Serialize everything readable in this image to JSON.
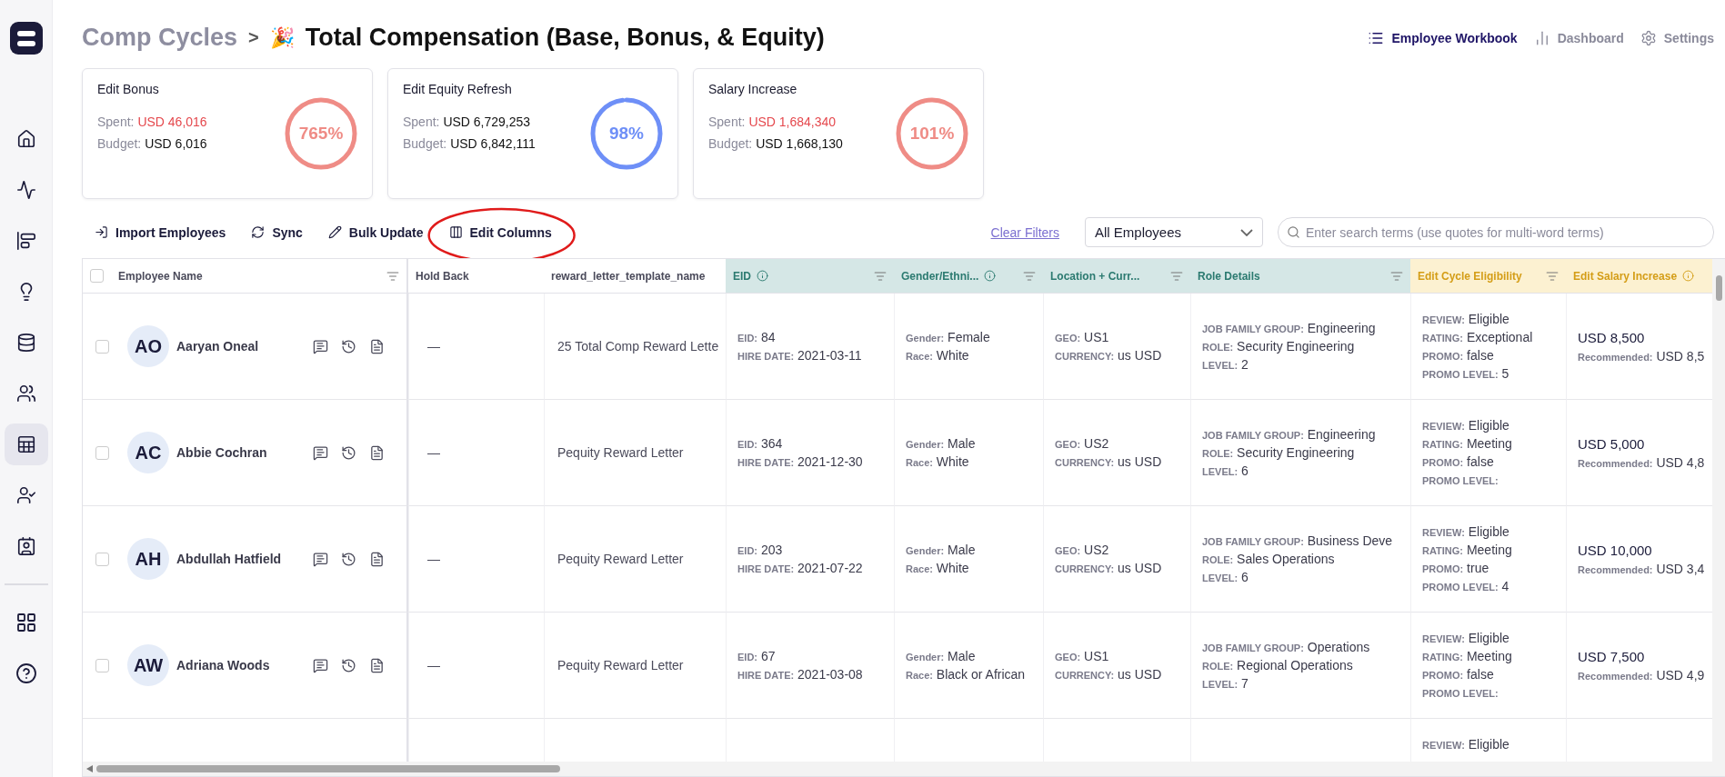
{
  "sidebar": {
    "items": [
      {
        "selected": false
      },
      {
        "selected": false
      },
      {
        "selected": false
      },
      {
        "selected": false
      },
      {
        "selected": false
      },
      {
        "selected": false
      },
      {
        "selected": true
      },
      {
        "selected": false
      },
      {
        "selected": false
      }
    ],
    "bottom": [
      {
        "selected": false
      },
      {
        "selected": false
      }
    ]
  },
  "breadcrumb": {
    "parent": "Comp Cycles",
    "separator": ">",
    "emoji": "🎉",
    "title": "Total Compensation (Base, Bonus, & Equity)"
  },
  "nav": [
    {
      "label": "Employee Workbook",
      "selected": true
    },
    {
      "label": "Dashboard",
      "selected": false
    },
    {
      "label": "Settings",
      "selected": false
    }
  ],
  "cards": [
    {
      "title": "Edit Bonus",
      "spent_label": "Spent:",
      "spent": "USD 46,016",
      "over": true,
      "budget_label": "Budget:",
      "budget": "USD 6,016",
      "percent": "765%",
      "level": 1,
      "color": "#ef8c86"
    },
    {
      "title": "Edit Equity Refresh",
      "spent_label": "Spent:",
      "spent": "USD 6,729,253",
      "over": false,
      "budget_label": "Budget:",
      "budget": "USD 6,842,111",
      "percent": "98%",
      "level": 0.98,
      "color": "#6e8ff7"
    },
    {
      "title": "Salary Increase",
      "spent_label": "Spent:",
      "spent": "USD 1,684,340",
      "over": true,
      "budget_label": "Budget:",
      "budget": "USD 1,668,130",
      "percent": "101%",
      "level": 1,
      "color": "#ef8c86"
    }
  ],
  "toolbar": {
    "actions": [
      {
        "label": "Import Employees",
        "highlighted": false
      },
      {
        "label": "Sync",
        "highlighted": false
      },
      {
        "label": "Bulk Update",
        "highlighted": false
      },
      {
        "label": "Edit Columns",
        "highlighted": true
      }
    ],
    "clear_filters": "Clear Filters",
    "filter_select": "All Employees",
    "search": {
      "placeholder": "Enter search terms (use quotes for multi-word terms)"
    }
  },
  "table": {
    "select_all": {
      "checked": false
    },
    "columns": [
      {
        "label": "Employee Name",
        "kind": "plain",
        "info": false,
        "filter": true
      },
      {
        "label": "Hold Back",
        "kind": "plain",
        "info": false,
        "filter": false
      },
      {
        "label": "reward_letter_template_name",
        "kind": "plain",
        "info": false,
        "filter": false
      },
      {
        "label": "EID",
        "kind": "teal",
        "info": true,
        "filter": true
      },
      {
        "label": "Gender/Ethni...",
        "kind": "teal",
        "info": true,
        "filter": true
      },
      {
        "label": "Location + Curr...",
        "kind": "teal",
        "info": false,
        "filter": true
      },
      {
        "label": "Role Details",
        "kind": "teal",
        "info": false,
        "filter": true
      },
      {
        "label": "Edit Cycle Eligibility",
        "kind": "gold",
        "info": false,
        "filter": true
      },
      {
        "label": "Edit Salary Increase",
        "kind": "gold",
        "info": true,
        "filter": false
      }
    ],
    "rows": [
      {
        "checked": false,
        "initials": "AO",
        "name": "Aaryan Oneal",
        "hold_back": "—",
        "reward_letter": "25 Total Comp Reward Lette",
        "eid": [
          {
            "label": "EID:",
            "value": "84"
          },
          {
            "label": "HIRE DATE:",
            "value": "2021-03-11"
          }
        ],
        "gender": [
          {
            "label": "Gender:",
            "value": "Female"
          },
          {
            "label": "Race:",
            "value": "White"
          }
        ],
        "location": [
          {
            "label": "GEO:",
            "value": "US1"
          },
          {
            "label": "CURRENCY:",
            "value": "us USD"
          }
        ],
        "role": [
          {
            "label": "JOB FAMILY GROUP:",
            "value": "Engineering"
          },
          {
            "label": "ROLE:",
            "value": "Security Engineering"
          },
          {
            "label": "LEVEL:",
            "value": "2"
          }
        ],
        "cycle": [
          {
            "label": "REVIEW:",
            "value": "Eligible"
          },
          {
            "label": "RATING:",
            "value": "Exceptional"
          },
          {
            "label": "PROMO:",
            "value": "false"
          },
          {
            "label": "PROMO LEVEL:",
            "value": "5"
          }
        ],
        "salary": "USD 8,500",
        "recommended_label": "Recommended:",
        "recommended": "USD 8,5"
      },
      {
        "checked": false,
        "initials": "AC",
        "name": "Abbie Cochran",
        "hold_back": "—",
        "reward_letter": "Pequity Reward Letter",
        "eid": [
          {
            "label": "EID:",
            "value": "364"
          },
          {
            "label": "HIRE DATE:",
            "value": "2021-12-30"
          }
        ],
        "gender": [
          {
            "label": "Gender:",
            "value": "Male"
          },
          {
            "label": "Race:",
            "value": "White"
          }
        ],
        "location": [
          {
            "label": "GEO:",
            "value": "US2"
          },
          {
            "label": "CURRENCY:",
            "value": "us USD"
          }
        ],
        "role": [
          {
            "label": "JOB FAMILY GROUP:",
            "value": "Engineering"
          },
          {
            "label": "ROLE:",
            "value": "Security Engineering"
          },
          {
            "label": "LEVEL:",
            "value": "6"
          }
        ],
        "cycle": [
          {
            "label": "REVIEW:",
            "value": "Eligible"
          },
          {
            "label": "RATING:",
            "value": "Meeting"
          },
          {
            "label": "PROMO:",
            "value": "false"
          },
          {
            "label": "PROMO LEVEL:"
          }
        ],
        "salary": "USD 5,000",
        "recommended_label": "Recommended:",
        "recommended": "USD 4,8"
      },
      {
        "checked": false,
        "initials": "AH",
        "name": "Abdullah Hatfield",
        "hold_back": "—",
        "reward_letter": "Pequity Reward Letter",
        "eid": [
          {
            "label": "EID:",
            "value": "203"
          },
          {
            "label": "HIRE DATE:",
            "value": "2021-07-22"
          }
        ],
        "gender": [
          {
            "label": "Gender:",
            "value": "Male"
          },
          {
            "label": "Race:",
            "value": "White"
          }
        ],
        "location": [
          {
            "label": "GEO:",
            "value": "US2"
          },
          {
            "label": "CURRENCY:",
            "value": "us USD"
          }
        ],
        "role": [
          {
            "label": "JOB FAMILY GROUP:",
            "value": "Business Deve"
          },
          {
            "label": "ROLE:",
            "value": "Sales Operations"
          },
          {
            "label": "LEVEL:",
            "value": "6"
          }
        ],
        "cycle": [
          {
            "label": "REVIEW:",
            "value": "Eligible"
          },
          {
            "label": "RATING:",
            "value": "Meeting"
          },
          {
            "label": "PROMO:",
            "value": "true"
          },
          {
            "label": "PROMO LEVEL:",
            "value": "4"
          }
        ],
        "salary": "USD 10,000",
        "recommended_label": "Recommended:",
        "recommended": "USD 3,4"
      },
      {
        "checked": false,
        "initials": "AW",
        "name": "Adriana Woods",
        "hold_back": "—",
        "reward_letter": "Pequity Reward Letter",
        "eid": [
          {
            "label": "EID:",
            "value": "67"
          },
          {
            "label": "HIRE DATE:",
            "value": "2021-03-08"
          }
        ],
        "gender": [
          {
            "label": "Gender:",
            "value": "Male"
          },
          {
            "label": "Race:",
            "value": "Black or African"
          }
        ],
        "location": [
          {
            "label": "GEO:",
            "value": "US1"
          },
          {
            "label": "CURRENCY:",
            "value": "us USD"
          }
        ],
        "role": [
          {
            "label": "JOB FAMILY GROUP:",
            "value": "Operations"
          },
          {
            "label": "ROLE:",
            "value": "Regional Operations"
          },
          {
            "label": "LEVEL:",
            "value": "7"
          }
        ],
        "cycle": [
          {
            "label": "REVIEW:",
            "value": "Eligible"
          },
          {
            "label": "RATING:",
            "value": "Meeting"
          },
          {
            "label": "PROMO:",
            "value": "false"
          },
          {
            "label": "PROMO LEVEL:"
          }
        ],
        "salary": "USD 7,500",
        "recommended_label": "Recommended:",
        "recommended": "USD 4,9"
      }
    ],
    "partial_row": {
      "cycle": [
        {
          "label": "REVIEW:",
          "value": "Eligible"
        }
      ]
    }
  }
}
